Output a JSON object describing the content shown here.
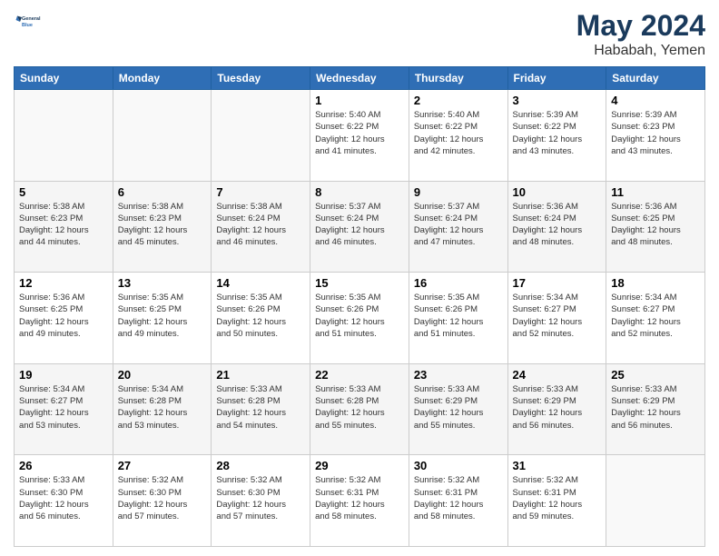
{
  "header": {
    "logo_line1": "General",
    "logo_line2": "Blue",
    "title": "May 2024",
    "location": "Hababah, Yemen"
  },
  "days_of_week": [
    "Sunday",
    "Monday",
    "Tuesday",
    "Wednesday",
    "Thursday",
    "Friday",
    "Saturday"
  ],
  "weeks": [
    {
      "days": [
        {
          "num": "",
          "info": ""
        },
        {
          "num": "",
          "info": ""
        },
        {
          "num": "",
          "info": ""
        },
        {
          "num": "1",
          "info": "Sunrise: 5:40 AM\nSunset: 6:22 PM\nDaylight: 12 hours\nand 41 minutes."
        },
        {
          "num": "2",
          "info": "Sunrise: 5:40 AM\nSunset: 6:22 PM\nDaylight: 12 hours\nand 42 minutes."
        },
        {
          "num": "3",
          "info": "Sunrise: 5:39 AM\nSunset: 6:22 PM\nDaylight: 12 hours\nand 43 minutes."
        },
        {
          "num": "4",
          "info": "Sunrise: 5:39 AM\nSunset: 6:23 PM\nDaylight: 12 hours\nand 43 minutes."
        }
      ]
    },
    {
      "days": [
        {
          "num": "5",
          "info": "Sunrise: 5:38 AM\nSunset: 6:23 PM\nDaylight: 12 hours\nand 44 minutes."
        },
        {
          "num": "6",
          "info": "Sunrise: 5:38 AM\nSunset: 6:23 PM\nDaylight: 12 hours\nand 45 minutes."
        },
        {
          "num": "7",
          "info": "Sunrise: 5:38 AM\nSunset: 6:24 PM\nDaylight: 12 hours\nand 46 minutes."
        },
        {
          "num": "8",
          "info": "Sunrise: 5:37 AM\nSunset: 6:24 PM\nDaylight: 12 hours\nand 46 minutes."
        },
        {
          "num": "9",
          "info": "Sunrise: 5:37 AM\nSunset: 6:24 PM\nDaylight: 12 hours\nand 47 minutes."
        },
        {
          "num": "10",
          "info": "Sunrise: 5:36 AM\nSunset: 6:24 PM\nDaylight: 12 hours\nand 48 minutes."
        },
        {
          "num": "11",
          "info": "Sunrise: 5:36 AM\nSunset: 6:25 PM\nDaylight: 12 hours\nand 48 minutes."
        }
      ]
    },
    {
      "days": [
        {
          "num": "12",
          "info": "Sunrise: 5:36 AM\nSunset: 6:25 PM\nDaylight: 12 hours\nand 49 minutes."
        },
        {
          "num": "13",
          "info": "Sunrise: 5:35 AM\nSunset: 6:25 PM\nDaylight: 12 hours\nand 49 minutes."
        },
        {
          "num": "14",
          "info": "Sunrise: 5:35 AM\nSunset: 6:26 PM\nDaylight: 12 hours\nand 50 minutes."
        },
        {
          "num": "15",
          "info": "Sunrise: 5:35 AM\nSunset: 6:26 PM\nDaylight: 12 hours\nand 51 minutes."
        },
        {
          "num": "16",
          "info": "Sunrise: 5:35 AM\nSunset: 6:26 PM\nDaylight: 12 hours\nand 51 minutes."
        },
        {
          "num": "17",
          "info": "Sunrise: 5:34 AM\nSunset: 6:27 PM\nDaylight: 12 hours\nand 52 minutes."
        },
        {
          "num": "18",
          "info": "Sunrise: 5:34 AM\nSunset: 6:27 PM\nDaylight: 12 hours\nand 52 minutes."
        }
      ]
    },
    {
      "days": [
        {
          "num": "19",
          "info": "Sunrise: 5:34 AM\nSunset: 6:27 PM\nDaylight: 12 hours\nand 53 minutes."
        },
        {
          "num": "20",
          "info": "Sunrise: 5:34 AM\nSunset: 6:28 PM\nDaylight: 12 hours\nand 53 minutes."
        },
        {
          "num": "21",
          "info": "Sunrise: 5:33 AM\nSunset: 6:28 PM\nDaylight: 12 hours\nand 54 minutes."
        },
        {
          "num": "22",
          "info": "Sunrise: 5:33 AM\nSunset: 6:28 PM\nDaylight: 12 hours\nand 55 minutes."
        },
        {
          "num": "23",
          "info": "Sunrise: 5:33 AM\nSunset: 6:29 PM\nDaylight: 12 hours\nand 55 minutes."
        },
        {
          "num": "24",
          "info": "Sunrise: 5:33 AM\nSunset: 6:29 PM\nDaylight: 12 hours\nand 56 minutes."
        },
        {
          "num": "25",
          "info": "Sunrise: 5:33 AM\nSunset: 6:29 PM\nDaylight: 12 hours\nand 56 minutes."
        }
      ]
    },
    {
      "days": [
        {
          "num": "26",
          "info": "Sunrise: 5:33 AM\nSunset: 6:30 PM\nDaylight: 12 hours\nand 56 minutes."
        },
        {
          "num": "27",
          "info": "Sunrise: 5:32 AM\nSunset: 6:30 PM\nDaylight: 12 hours\nand 57 minutes."
        },
        {
          "num": "28",
          "info": "Sunrise: 5:32 AM\nSunset: 6:30 PM\nDaylight: 12 hours\nand 57 minutes."
        },
        {
          "num": "29",
          "info": "Sunrise: 5:32 AM\nSunset: 6:31 PM\nDaylight: 12 hours\nand 58 minutes."
        },
        {
          "num": "30",
          "info": "Sunrise: 5:32 AM\nSunset: 6:31 PM\nDaylight: 12 hours\nand 58 minutes."
        },
        {
          "num": "31",
          "info": "Sunrise: 5:32 AM\nSunset: 6:31 PM\nDaylight: 12 hours\nand 59 minutes."
        },
        {
          "num": "",
          "info": ""
        }
      ]
    }
  ]
}
